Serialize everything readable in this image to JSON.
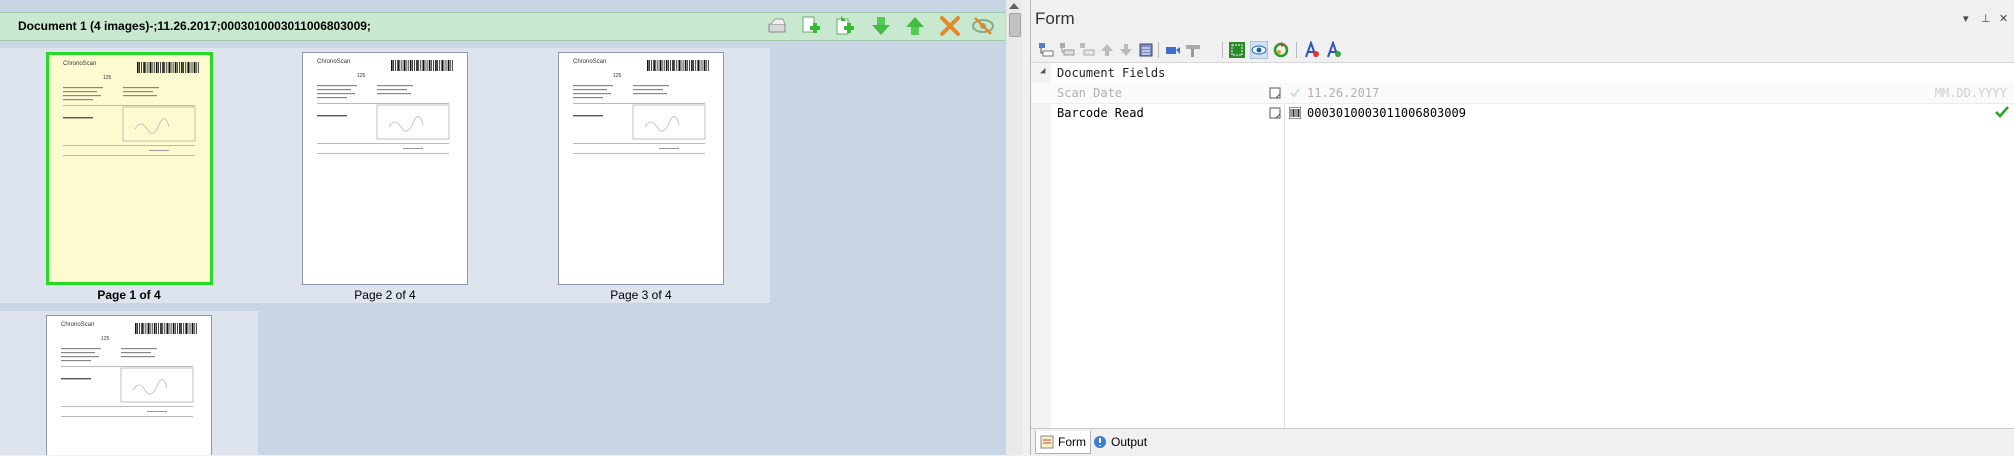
{
  "document": {
    "title": "Document 1 (4 images)-;11.26.2017;000301000301100680​3009;",
    "pages": [
      {
        "label": "Page 1 of 4",
        "selected": true
      },
      {
        "label": "Page 2 of 4",
        "selected": false
      },
      {
        "label": "Page 3 of 4",
        "selected": false
      },
      {
        "label": "",
        "selected": false
      }
    ],
    "thumb_text": {
      "brand": "ChronoScan",
      "number": "125"
    },
    "toolbar_icons": [
      "scanner-icon",
      "insert-page-icon",
      "append-page-icon",
      "move-down-icon",
      "move-up-icon",
      "delete-icon",
      "hide-icon"
    ]
  },
  "form": {
    "title": "Form",
    "window_buttons": {
      "dropdown": "▾",
      "pin": "⊥",
      "close": "✕"
    },
    "toolbar_icons": [
      "add-field-icon",
      "insert-field-icon",
      "remove-field-icon",
      "move-field-up-icon",
      "move-field-down-icon",
      "field-list-icon",
      "ocr-zone-icon",
      "field-properties-icon",
      "select-zone-icon",
      "view-icon",
      "refresh-icon",
      "font-icon",
      "font-add-icon"
    ],
    "section": {
      "toggle": "◢",
      "label": "Document Fields"
    },
    "fields": [
      {
        "name": "Scan Date",
        "value": "11.26.2017",
        "format": "MM.DD.YYYY"
      },
      {
        "name": "Barcode Read",
        "value": "000301000301100680​3009"
      }
    ],
    "tabs": [
      {
        "label": "Form",
        "active": true
      },
      {
        "label": "Output",
        "active": false
      }
    ]
  },
  "colors": {
    "accent_green": "#22dd22",
    "header_green": "#c8e8d0",
    "pane_blue": "#c8d5e5"
  }
}
